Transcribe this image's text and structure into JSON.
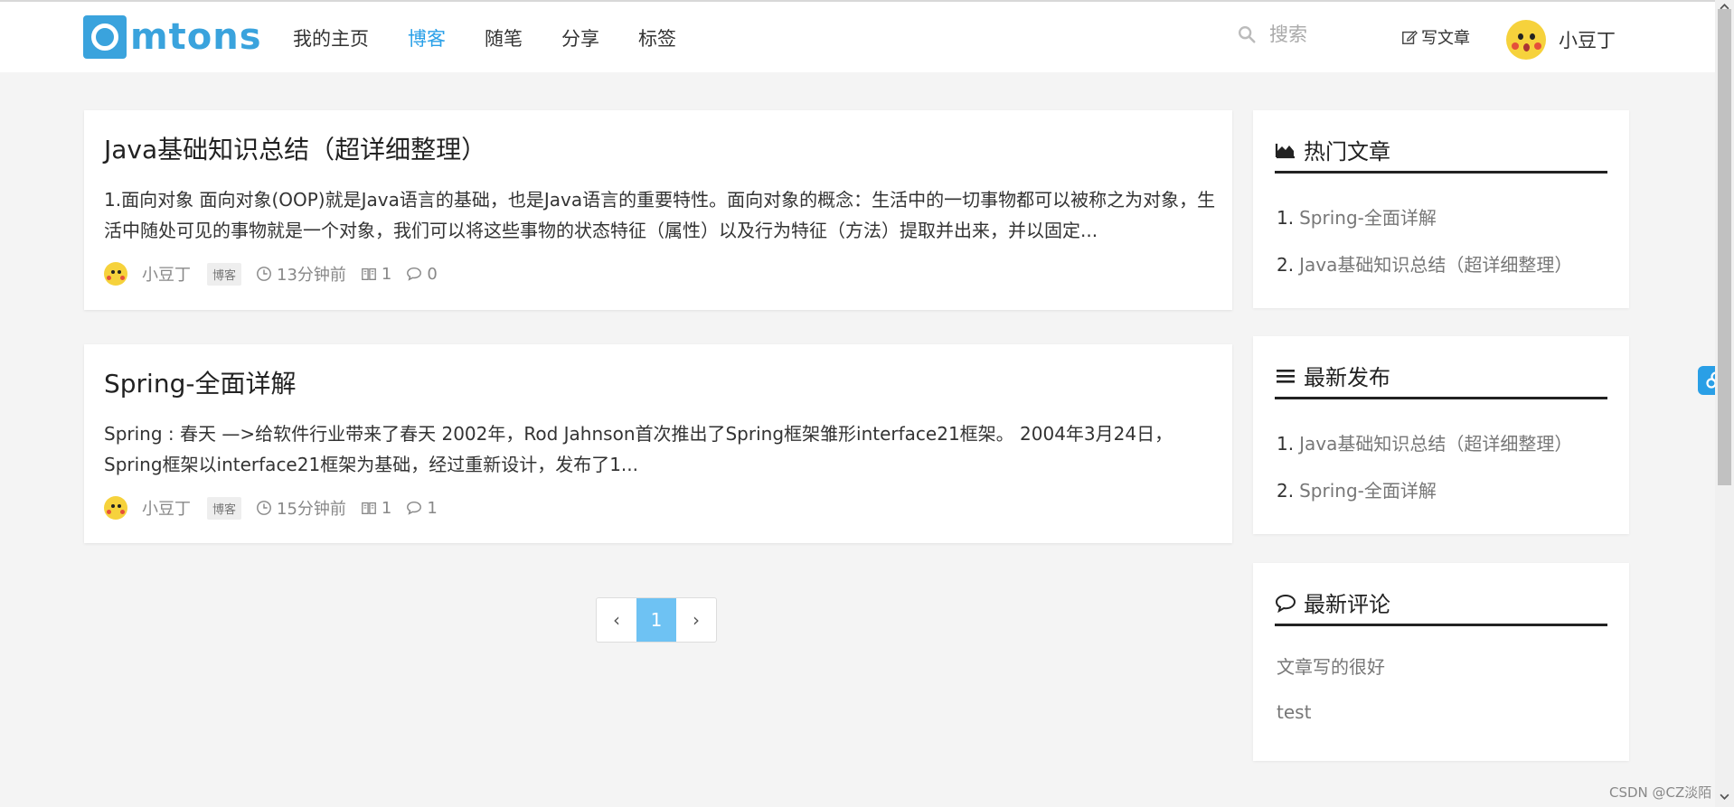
{
  "header": {
    "logo_text": "mtons",
    "nav": [
      "我的主页",
      "博客",
      "随笔",
      "分享",
      "标签"
    ],
    "active_nav": "博客",
    "search_placeholder": "搜索",
    "write_label": "写文章",
    "user_name": "小豆丁"
  },
  "posts": [
    {
      "title": "Java基础知识总结（超详细整理）",
      "summary": "1.面向对象 面向对象(OOP)就是Java语言的基础，也是Java语言的重要特性。面向对象的概念：生活中的一切事物都可以被称之为对象，生活中随处可见的事物就是一个对象，我们可以将这些事物的状态特征（属性）以及行为特征（方法）提取并出来，并以固定...",
      "author": "小豆丁",
      "tag": "博客",
      "time": "13分钟前",
      "views": "1",
      "comments": "0"
    },
    {
      "title": "Spring-全面详解",
      "summary": "Spring : 春天 —>给软件行业带来了春天 2002年，Rod Jahnson首次推出了Spring框架雏形interface21框架。 2004年3月24日，Spring框架以interface21框架为基础，经过重新设计，发布了1...",
      "author": "小豆丁",
      "tag": "博客",
      "time": "15分钟前",
      "views": "1",
      "comments": "1"
    }
  ],
  "pagination": {
    "prev": "‹",
    "current": "1",
    "next": "›"
  },
  "sidebar": {
    "hot": {
      "title": "热门文章",
      "items": [
        "Spring-全面详解",
        "Java基础知识总结（超详细整理）"
      ]
    },
    "latest": {
      "title": "最新发布",
      "items": [
        "Java基础知识总结（超详细整理）",
        "Spring-全面详解"
      ]
    },
    "comments": {
      "title": "最新评论",
      "items": [
        "文章写的很好",
        "test"
      ]
    }
  },
  "numbers": [
    "1.",
    "2."
  ],
  "watermark": "CSDN @CZ淡陌",
  "colors": {
    "accent": "#2aa0e8",
    "logo": "#3aa3dd",
    "page_active": "#6ec2f3"
  }
}
